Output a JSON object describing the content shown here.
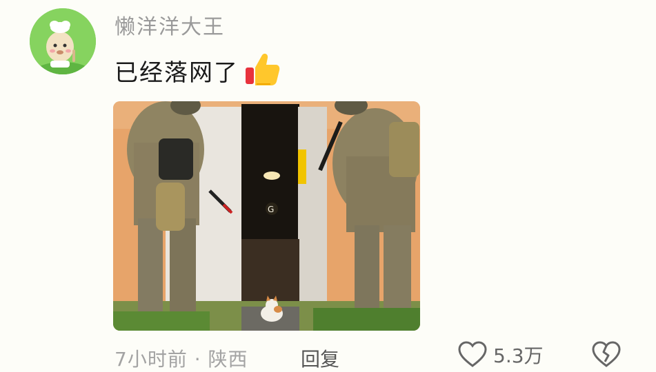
{
  "comment": {
    "username": "懒洋洋大王",
    "text": "已经落网了",
    "emoji_icon": "thumbs-up-icon",
    "image_icon": "photo-soldiers-and-kitten",
    "meta": "7小时前 · 陕西",
    "reply_label": "回复",
    "like_count": "5.3万",
    "like_icon": "heart-outline-icon",
    "dislike_icon": "broken-heart-icon"
  },
  "colors": {
    "background": "#fdfdf8",
    "username": "#9a9a9a",
    "text": "#1a1a1a",
    "meta": "#a3a3a3"
  }
}
